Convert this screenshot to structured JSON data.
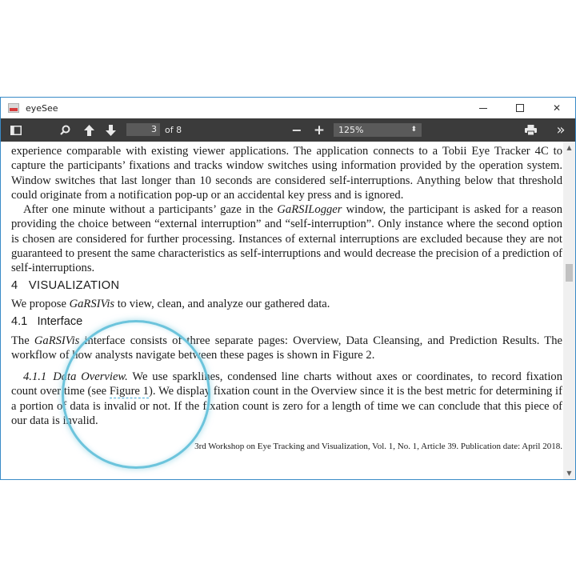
{
  "window": {
    "title": "eyeSee",
    "controls": {
      "minimize_icon": "minimize-icon",
      "maximize_icon": "maximize-icon",
      "close_glyph": "✕"
    }
  },
  "toolbar": {
    "sidebar_icon": "sidebar-toggle-icon",
    "search_icon": "search-icon",
    "prev_icon": "arrow-up-icon",
    "next_icon": "arrow-down-icon",
    "page_current": "3",
    "page_total": "of 8",
    "zoom_out_glyph": "−",
    "zoom_in_glyph": "+",
    "zoom_value": "125%",
    "zoom_caret": "⬍",
    "print_icon": "printer-icon",
    "more_glyph": "»"
  },
  "document": {
    "p1": "experience comparable with existing viewer applications. The application connects to a Tobii Eye Tracker 4C to capture the participants’ fixations and tracks window switches using information provided by the operation system. Window switches that last longer than 10 seconds are considered self-interruptions. Anything below that threshold could originate from a notification pop-up or an accidental key press and is ignored.",
    "p2_a": "After one minute without a participants’ gaze in the ",
    "p2_em": "GaRSILogger",
    "p2_b": " window, the participant is asked for a reason providing the choice between “external interruption” and “self-interruption”. Only instance where the second option is chosen are considered for further processing. Instances of external interruptions are excluded because they are not guaranteed to present the same characteristics as self-interruptions and would decrease the precision of a prediction of self-interruptions.",
    "section_num": "4",
    "section_title": "VISUALIZATION",
    "p3_a": "We propose ",
    "p3_em": "GaRSIVis",
    "p3_b": " to view, clean, and analyze our gathered data.",
    "subsection_num": "4.1",
    "subsection_title": "Interface",
    "p4_a": "The ",
    "p4_em": "GaRSIVis",
    "p4_b": " interface consists of three separate pages: Overview, Data Cleansing, and Prediction Results. The workflow of how analysts navigate between these pages is shown in Figure 2.",
    "subsub_num": "4.1.1",
    "subsub_title": "Data Overview.",
    "p5_a": " We use sparklines, condensed line charts without axes or coordinates, to record fixation count over time (see ",
    "p5_link": "Figure 1",
    "p5_b": "). We display fixation count in the Overview since it is the best metric for determining if a portion of data is invalid or not. If the fixation count is zero for a length of time we can conclude that this piece of our data is invalid.",
    "footer": "3rd Workshop on Eye Tracking and Visualization, Vol. 1, No. 1, Article 39. Publication date: April 2018."
  },
  "scrollbar": {
    "up_glyph": "▲",
    "down_glyph": "▼"
  },
  "colors": {
    "toolbar_bg": "#3b3b3b",
    "window_border": "#3a8bc7",
    "magnifier_ring": "#6cc4dc"
  }
}
